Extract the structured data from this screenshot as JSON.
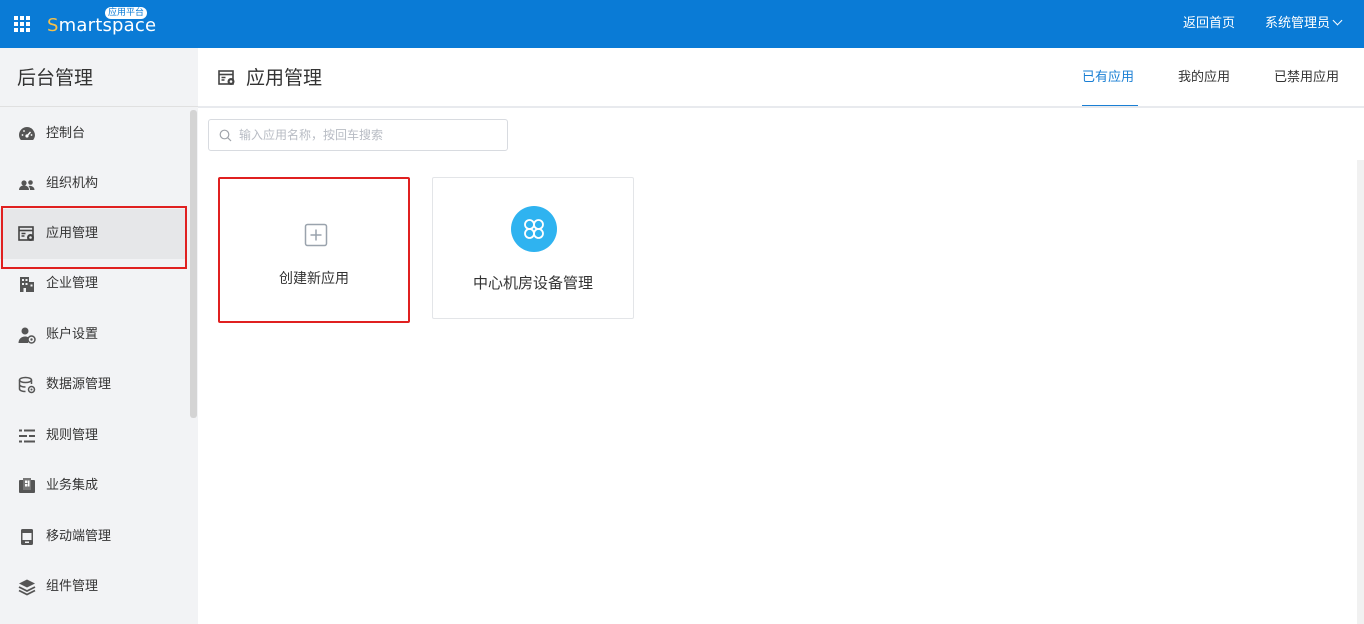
{
  "topbar": {
    "logo_s": "S",
    "logo_rest": "martspace",
    "logo_badge": "应用平台",
    "home_link": "返回首页",
    "user_menu": "系统管理员"
  },
  "sidebar": {
    "title": "后台管理",
    "items": [
      {
        "label": "控制台",
        "icon": "dashboard-icon"
      },
      {
        "label": "组织机构",
        "icon": "users-icon"
      },
      {
        "label": "应用管理",
        "icon": "app-settings-icon",
        "active": true
      },
      {
        "label": "企业管理",
        "icon": "building-icon"
      },
      {
        "label": "账户设置",
        "icon": "user-gear-icon"
      },
      {
        "label": "数据源管理",
        "icon": "database-icon"
      },
      {
        "label": "规则管理",
        "icon": "rules-icon"
      },
      {
        "label": "业务集成",
        "icon": "integration-icon"
      },
      {
        "label": "移动端管理",
        "icon": "mobile-icon"
      },
      {
        "label": "组件管理",
        "icon": "layers-icon"
      }
    ]
  },
  "main": {
    "title": "应用管理",
    "tabs": [
      {
        "label": "已有应用",
        "active": true
      },
      {
        "label": "我的应用"
      },
      {
        "label": "已禁用应用"
      }
    ],
    "search": {
      "placeholder": "输入应用名称，按回车搜索"
    },
    "cards": [
      {
        "label": "创建新应用",
        "icon": "plus-icon"
      },
      {
        "label": "中心机房设备管理",
        "icon": "clover-icon"
      }
    ]
  },
  "colors": {
    "topbar": "#0a7bd6",
    "accent": "#1a7fd4",
    "highlight": "#e02020",
    "app_icon": "#2fb3f0"
  }
}
